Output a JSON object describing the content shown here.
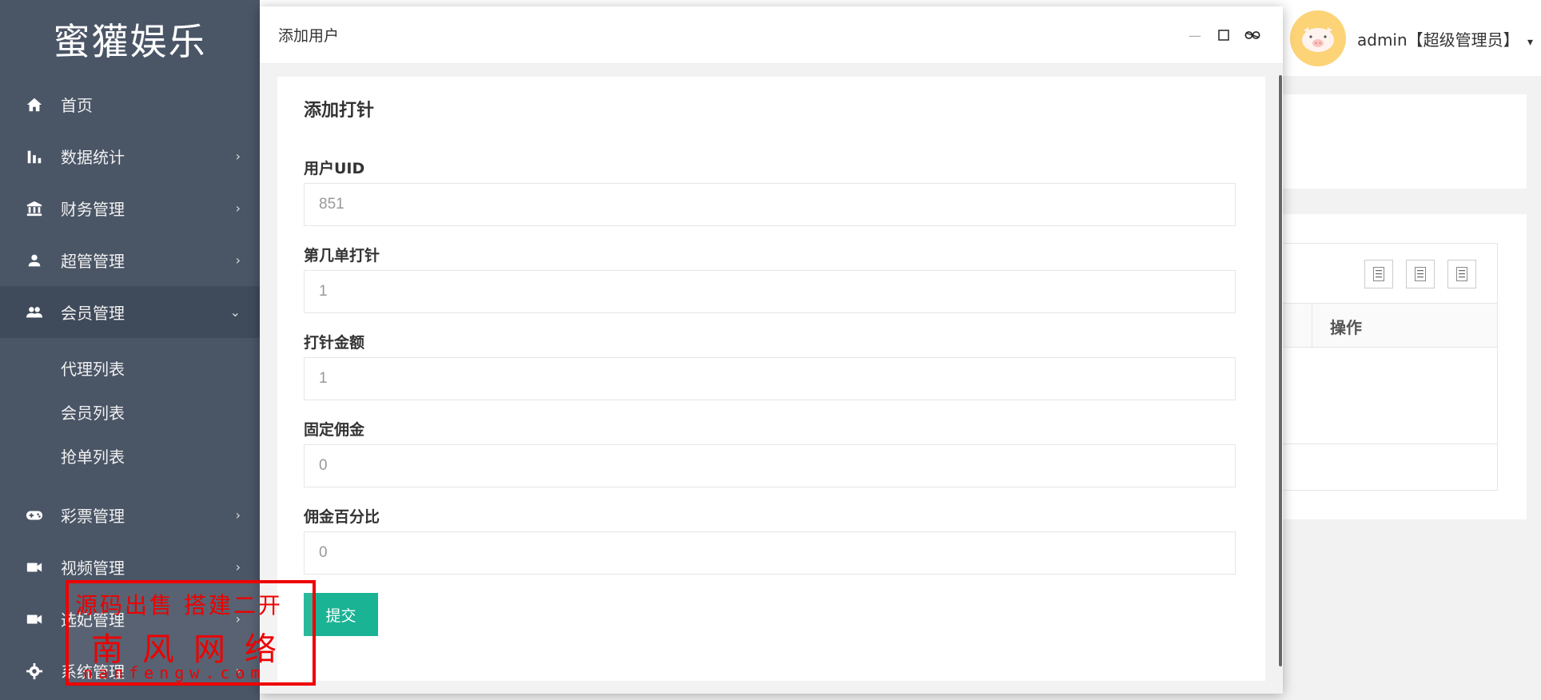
{
  "sidebar": {
    "brand": "蜜獾娱乐",
    "items": [
      {
        "label": "首页",
        "icon": "home-icon",
        "arrow": ""
      },
      {
        "label": "数据统计",
        "icon": "bar-chart-icon",
        "arrow": "›"
      },
      {
        "label": "财务管理",
        "icon": "bank-icon",
        "arrow": "›"
      },
      {
        "label": "超管管理",
        "icon": "person-icon",
        "arrow": "›"
      },
      {
        "label": "会员管理",
        "icon": "people-icon",
        "arrow": "⌄"
      }
    ],
    "sub_items": [
      {
        "label": "代理列表"
      },
      {
        "label": "会员列表"
      },
      {
        "label": "抢单列表"
      }
    ],
    "items_after": [
      {
        "label": "彩票管理",
        "icon": "gamepad-icon",
        "arrow": "›"
      },
      {
        "label": "视频管理",
        "icon": "video-icon",
        "arrow": "›"
      },
      {
        "label": "选妃管理",
        "icon": "video-icon",
        "arrow": "›"
      },
      {
        "label": "系统管理",
        "icon": "gear-icon",
        "arrow": "›"
      }
    ]
  },
  "header": {
    "user": "admin【超级管理员】",
    "dropdown_caret": "▾"
  },
  "background": {
    "column_header": "操作"
  },
  "modal": {
    "title": "添加用户",
    "minimize": "—",
    "maximize": "□",
    "close": "✕"
  },
  "form": {
    "title": "添加打针",
    "fields": [
      {
        "label": "用户UID",
        "value": "851"
      },
      {
        "label": "第几单打针",
        "value": "1"
      },
      {
        "label": "打针金额",
        "value": "1"
      },
      {
        "label": "固定佣金",
        "value": "0"
      },
      {
        "label": "佣金百分比",
        "value": "0"
      }
    ],
    "submit": "提交"
  },
  "watermark": {
    "line1": "源码出售 搭建二开",
    "line2": "南风网络",
    "line3": "nanfengw.com"
  }
}
